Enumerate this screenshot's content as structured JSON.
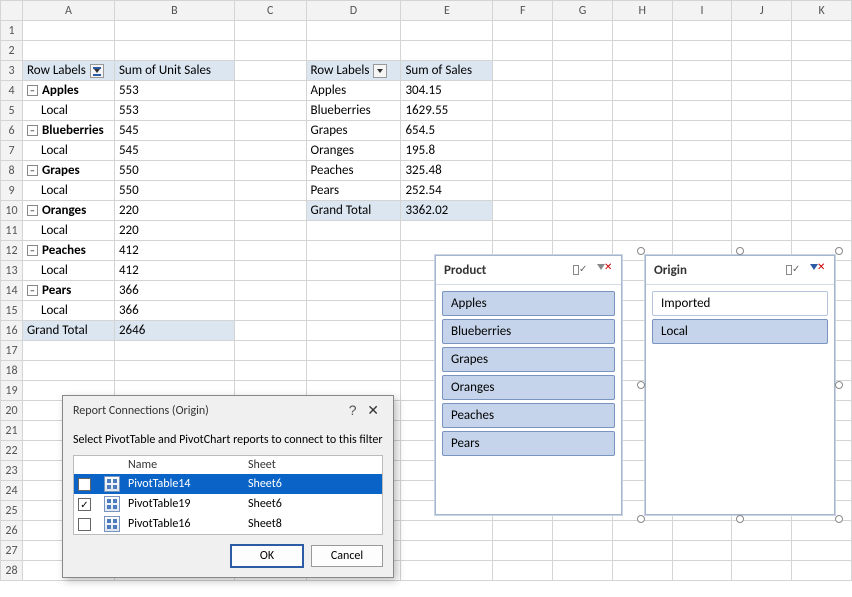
{
  "columns": [
    "A",
    "B",
    "C",
    "D",
    "E",
    "F",
    "G",
    "H",
    "I",
    "J",
    "K"
  ],
  "row_count": 28,
  "pivot1": {
    "row_header": "Row Labels",
    "value_header": "Sum of Unit Sales",
    "rows": [
      {
        "label": "Apples",
        "value": 553,
        "child": {
          "label": "Local",
          "value": 553
        }
      },
      {
        "label": "Blueberries",
        "value": 545,
        "child": {
          "label": "Local",
          "value": 545
        }
      },
      {
        "label": "Grapes",
        "value": 550,
        "child": {
          "label": "Local",
          "value": 550
        }
      },
      {
        "label": "Oranges",
        "value": 220,
        "child": {
          "label": "Local",
          "value": 220
        }
      },
      {
        "label": "Peaches",
        "value": 412,
        "child": {
          "label": "Local",
          "value": 412
        }
      },
      {
        "label": "Pears",
        "value": 366,
        "child": {
          "label": "Local",
          "value": 366
        }
      }
    ],
    "grand_label": "Grand Total",
    "grand_value": 2646
  },
  "pivot2": {
    "row_header": "Row Labels",
    "value_header": "Sum of Sales",
    "rows": [
      {
        "label": "Apples",
        "value": 304.15
      },
      {
        "label": "Blueberries",
        "value": 1629.55
      },
      {
        "label": "Grapes",
        "value": 654.5
      },
      {
        "label": "Oranges",
        "value": 195.8
      },
      {
        "label": "Peaches",
        "value": 325.48
      },
      {
        "label": "Pears",
        "value": 252.54
      }
    ],
    "grand_label": "Grand Total",
    "grand_value": 3362.02
  },
  "slicer1": {
    "title": "Product",
    "items": [
      "Apples",
      "Blueberries",
      "Grapes",
      "Oranges",
      "Peaches",
      "Pears"
    ]
  },
  "slicer2": {
    "title": "Origin",
    "items": [
      {
        "label": "Imported",
        "selected": false
      },
      {
        "label": "Local",
        "selected": true
      }
    ]
  },
  "dialog": {
    "title": "Report Connections (Origin)",
    "prompt": "Select PivotTable and PivotChart reports to connect to this filter",
    "cols": {
      "name": "Name",
      "sheet": "Sheet"
    },
    "rows": [
      {
        "checked": true,
        "name": "PivotTable14",
        "sheet": "Sheet6",
        "selected": true
      },
      {
        "checked": true,
        "name": "PivotTable19",
        "sheet": "Sheet6",
        "selected": false
      },
      {
        "checked": false,
        "name": "PivotTable16",
        "sheet": "Sheet8",
        "selected": false
      }
    ],
    "ok": "OK",
    "cancel": "Cancel"
  }
}
